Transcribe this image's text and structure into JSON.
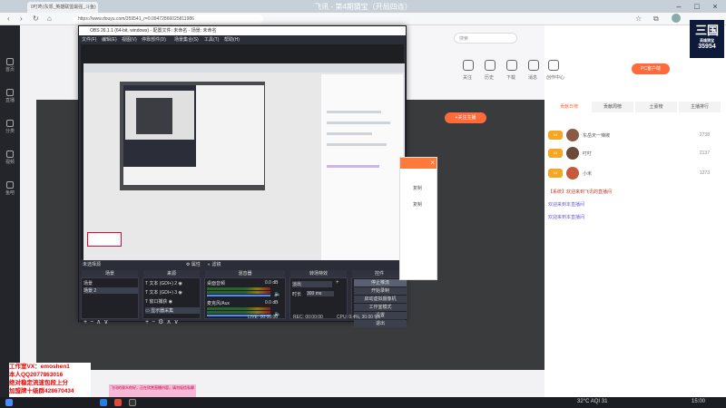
{
  "browser": {
    "tab_title": "0叮咚(东郊_英雄联盟最强_斗鱼)",
    "window_title": "飞讯 - 第4期猜宝（开局四连）",
    "url": "https://www.douyu.com/359541_r=0.09472866025811986",
    "nav_icons": [
      "back-icon",
      "forward-icon",
      "refresh-icon",
      "home-icon"
    ]
  },
  "site_sidebar": {
    "items": [
      {
        "label": "首页",
        "icon": "home-icon"
      },
      {
        "label": "直播",
        "icon": "live-icon"
      },
      {
        "label": "分类",
        "icon": "grid-icon"
      },
      {
        "label": "视频",
        "icon": "video-icon"
      },
      {
        "label": "鱼吧",
        "icon": "fish-icon"
      }
    ]
  },
  "site_header": {
    "search_placeholder": "搜索",
    "nav_labels": [
      "关注",
      "历史",
      "下载",
      "消息",
      "创作中心"
    ],
    "pc_client_label": "PC客户端",
    "follow_label": "+关注主播",
    "room_id": "35954"
  },
  "logo": {
    "big": "三国",
    "sub": "英雄猜宝",
    "num": "35954"
  },
  "right_panel": {
    "tabs": [
      "贡献日榜",
      "贡献周榜",
      "土豪榜",
      "主播排行"
    ],
    "ranks": [
      {
        "badge": "LV",
        "name": "东岳天一辣椒",
        "score": "2738"
      },
      {
        "badge": "LV",
        "name": "叮叮",
        "score": "2137"
      },
      {
        "badge": "LV",
        "name": "小米",
        "score": "1273"
      }
    ],
    "chat": [
      "【系统】欢迎来到飞讯的直播间",
      "欢迎来到本直播间",
      "欢迎来到本直播间"
    ]
  },
  "obs": {
    "title": "OBS 26.1.1 (64-bit, windows) - 配置文件: 未命名 - 场景: 未命名",
    "menu": [
      "文件(F)",
      "编辑(E)",
      "视图(V)",
      "停靠部件(D)",
      "场景集合(S)",
      "工具(T)",
      "帮助(H)"
    ],
    "dock_title": "未选择源",
    "properties_label": "属性",
    "filters_label": "滤镜",
    "scenes": {
      "head": "场景",
      "items": [
        "场景",
        "场景 2"
      ]
    },
    "sources": {
      "head": "来源",
      "items": [
        "文本 (GDI+) 2",
        "文本 (GDI+) 3",
        "窗口捕获",
        "显示器采集"
      ]
    },
    "mixer": {
      "head": "混音器",
      "tracks": [
        {
          "name": "桌面音频",
          "db": "0.0 dB"
        },
        {
          "name": "麦克风/Aux",
          "db": "0.0 dB"
        }
      ]
    },
    "transitions": {
      "head": "转场特效",
      "type": "淡出",
      "duration_label": "时长",
      "duration": "300 ms"
    },
    "controls": {
      "head": "控件",
      "buttons": [
        "停止推流",
        "开始录制",
        "启动虚拟摄像机",
        "工作室模式",
        "设置",
        "退出"
      ]
    },
    "status": {
      "live": "LIVE: 00:00:00",
      "rec": "REC: 00:00:00",
      "cpu": "CPU: 0.4%, 30.00 fps"
    }
  },
  "popup": {
    "items": [
      "复制",
      "复制"
    ]
  },
  "watermark": {
    "lines": [
      "工作室VX：emoshen1",
      "本人QQ2077863016",
      "绝对稳定流速包段上分",
      "加盟牌十级群428670434"
    ]
  },
  "notification": "飞讯的观众你好，正在欣赏直播内容，请勿轻信私聊",
  "taskbar": {
    "weather": "32°C AQI 31",
    "time": "15:00"
  }
}
